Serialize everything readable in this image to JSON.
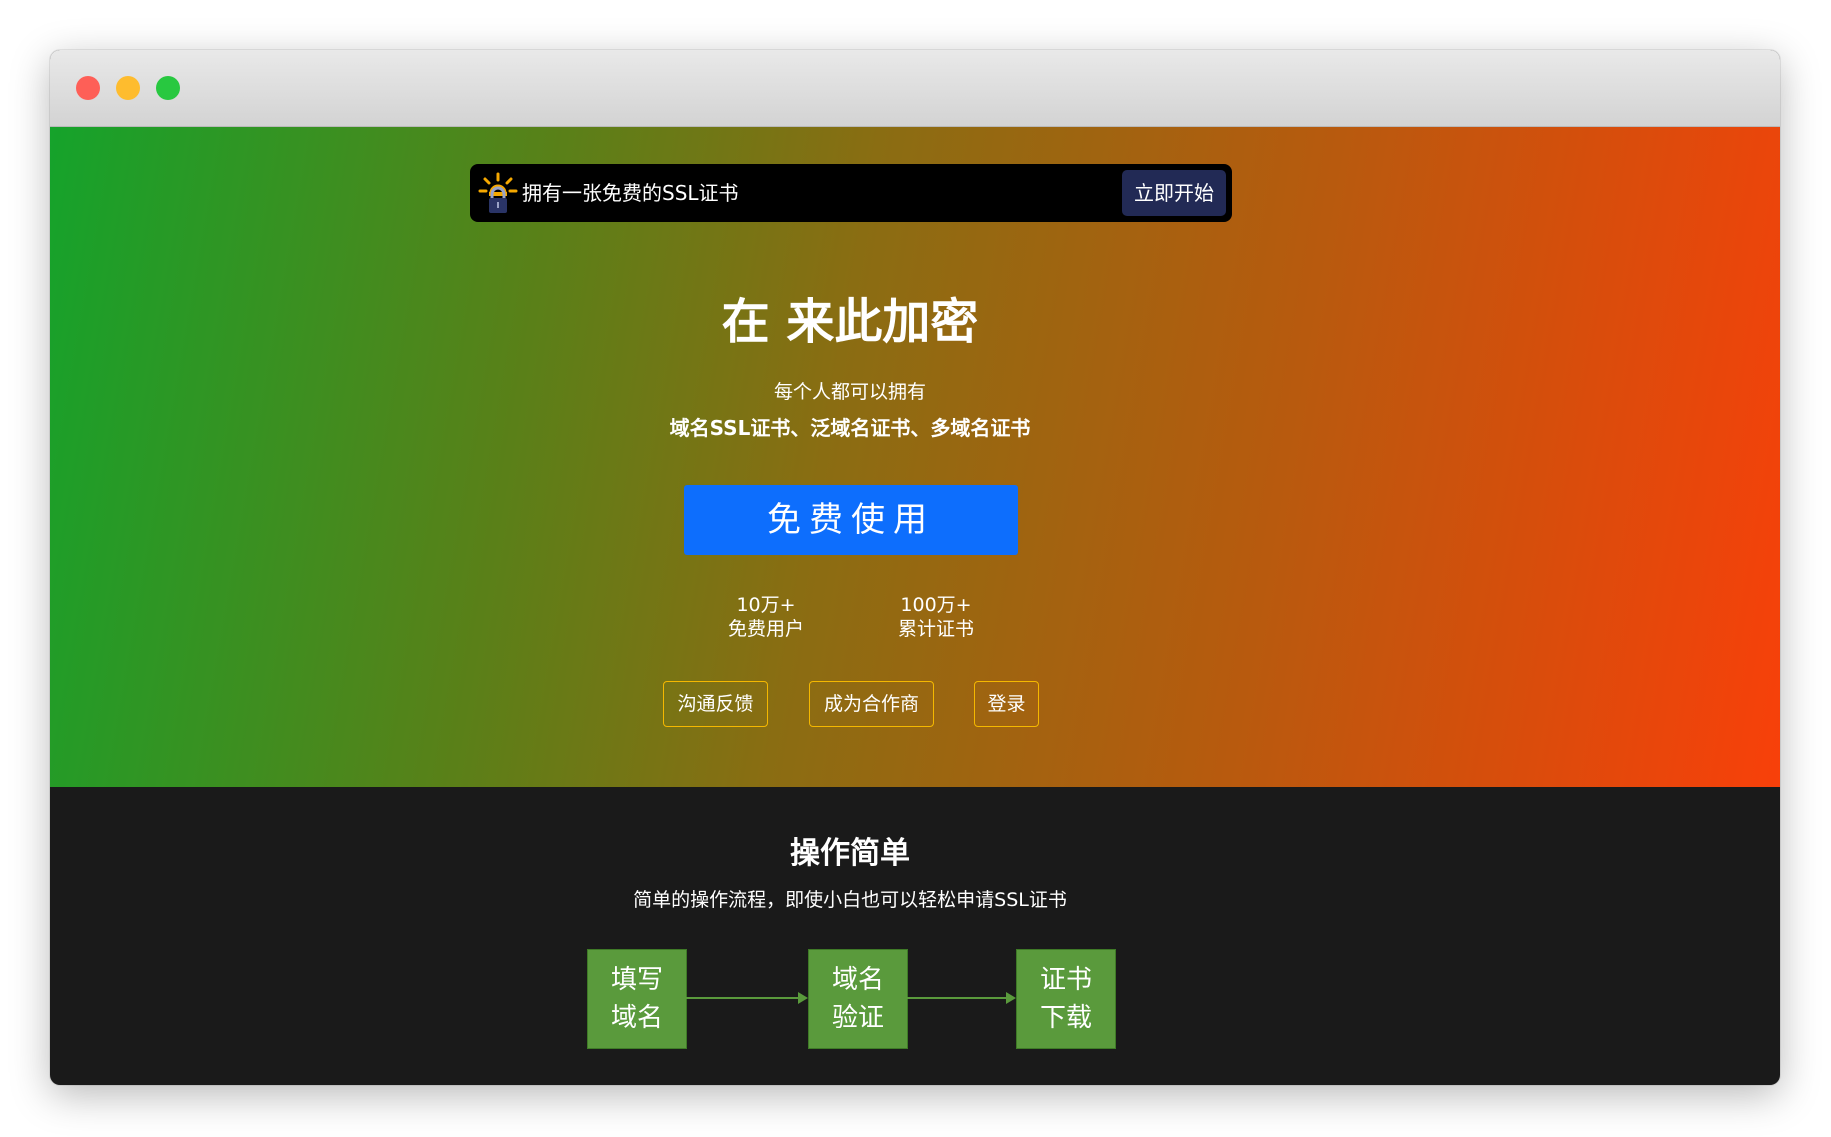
{
  "promo": {
    "text": "拥有一张免费的SSL证书",
    "button": "立即开始"
  },
  "hero": {
    "title": "在 来此加密",
    "subtitle": "每个人都可以拥有",
    "highlight": "域名SSL证书、泛域名证书、多域名证书",
    "cta": "免费使用",
    "stats": [
      {
        "value": "10万+",
        "label": "免费用户"
      },
      {
        "value": "100万+",
        "label": "累计证书"
      }
    ],
    "links": [
      "沟通反馈",
      "成为合作商",
      "登录"
    ]
  },
  "section": {
    "title": "操作简单",
    "subtitle": "简单的操作流程，即使小白也可以轻松申请SSL证书",
    "steps": [
      {
        "line1": "填写",
        "line2": "域名"
      },
      {
        "line1": "域名",
        "line2": "验证"
      },
      {
        "line1": "证书",
        "line2": "下载"
      }
    ]
  },
  "colors": {
    "cta": "#0d6efd",
    "step": "#5a9a3c",
    "link_border": "#f5b800",
    "promo_button": "#222a55",
    "dark_bg": "#1a1a1a"
  }
}
